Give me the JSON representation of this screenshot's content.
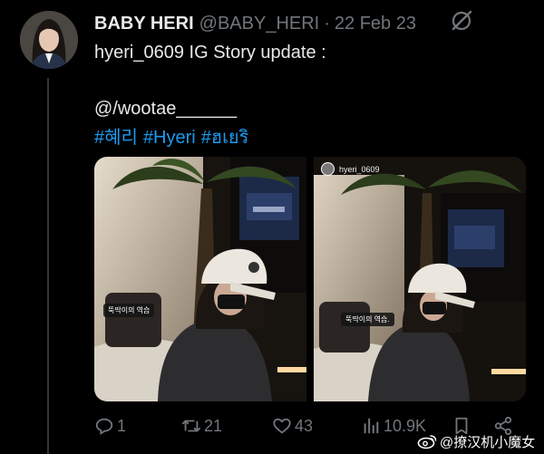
{
  "tweet": {
    "display_name": "BABY HERI",
    "handle": "@BABY_HERI",
    "separator": "·",
    "date": "22 Feb 23",
    "text_line1": "hyeri_0609 IG Story update :",
    "text_line2": "@/wootae______",
    "hashtags": [
      "#혜리",
      "#Hyeri",
      "#ฮเยริ"
    ]
  },
  "media": {
    "left_caption": "뚝딱이의 역습",
    "right_caption": "뚝딱이의 역습.",
    "right_story_user": "hyeri_0609"
  },
  "actions": {
    "replies": "1",
    "retweets": "21",
    "likes": "43",
    "views": "10.9K"
  },
  "watermark": {
    "text": "@撩汉机小魔女"
  },
  "colors": {
    "background": "#000000",
    "text": "#e7e9ea",
    "secondary": "#71767b",
    "link": "#1d9bf0"
  }
}
